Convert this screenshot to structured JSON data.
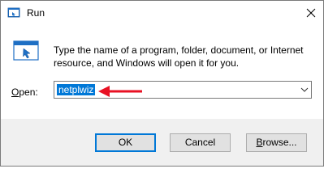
{
  "window": {
    "title": "Run",
    "close_icon": "close-icon",
    "app_icon": "run-app-icon"
  },
  "body": {
    "description": "Type the name of a program, folder, document, or Internet resource, and Windows will open it for you.",
    "open_label_accel": "O",
    "open_label_rest": "pen:",
    "open_value": "netplwiz",
    "annotation_color": "#e81123",
    "selection_color": "#0078d7"
  },
  "buttons": {
    "ok": "OK",
    "cancel": "Cancel",
    "browse_accel": "B",
    "browse_rest": "rowse..."
  }
}
